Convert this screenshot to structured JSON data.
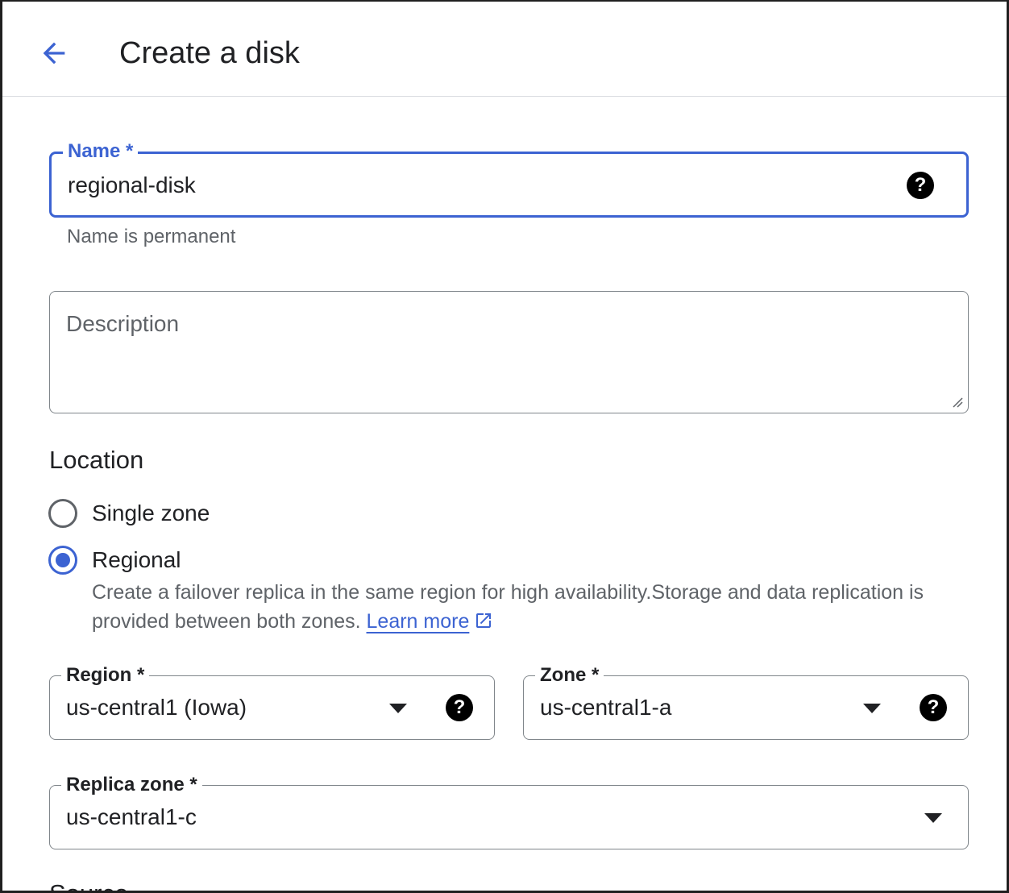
{
  "header": {
    "title": "Create a disk",
    "back_icon": "arrow-back-icon"
  },
  "colors": {
    "accent": "#3c63d2",
    "text": "#202124",
    "secondary_text": "#5f6368",
    "border": "#80868b"
  },
  "form": {
    "name": {
      "label": "Name *",
      "value": "regional-disk",
      "hint": "Name is permanent",
      "help_icon": "help-icon",
      "help_glyph": "?"
    },
    "description": {
      "placeholder": "Description"
    },
    "location": {
      "title": "Location",
      "options": [
        {
          "label": "Single zone",
          "selected": false
        },
        {
          "label": "Regional",
          "selected": true
        }
      ],
      "regional_description": "Create a failover replica in the same region for high availability.Storage and data replication is provided between both zones. ",
      "learn_more": "Learn more"
    },
    "region": {
      "label": "Region *",
      "value": "us-central1 (Iowa)",
      "help_glyph": "?"
    },
    "zone": {
      "label": "Zone *",
      "value": "us-central1-a",
      "help_glyph": "?"
    },
    "replica_zone": {
      "label": "Replica zone *",
      "value": "us-central1-c"
    },
    "next_section_title": "Source"
  }
}
